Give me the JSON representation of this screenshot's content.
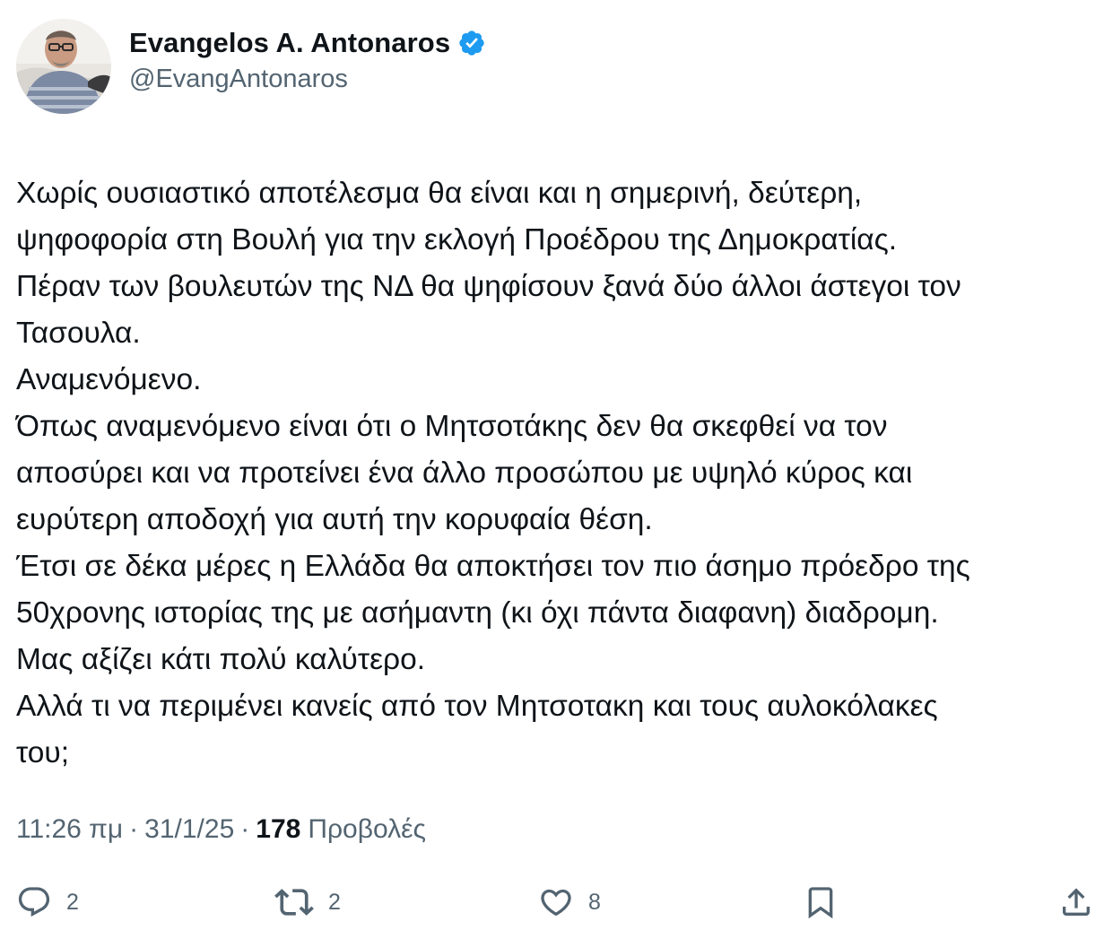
{
  "author": {
    "display_name": "Evangelos A. Antonaros",
    "handle": "@EvangAntonaros",
    "verified": true,
    "verified_color": "#1d9bf0"
  },
  "tweet": {
    "lines": [
      "Χωρίς ουσιαστικό αποτέλεσμα θα είναι και η σημερινή, δεύτερη,",
      "ψηφοφορία στη Βουλή για την εκλογή  Προέδρου της Δημοκρατίας.",
      "Πέραν των βουλευτών της ΝΔ θα ψηφίσουν ξανά δύο άλλοι άστεγοι τον",
      "Τασουλα.",
      "Αναμενόμενο.",
      "Όπως αναμενόμενο είναι ότι ο Μητσοτάκης δεν θα σκεφθεί να τον",
      "αποσύρει και να προτείνει ένα άλλο προσώπου με υψηλό κύρος και",
      "ευρύτερη αποδοχή για αυτή την κορυφαία θέση.",
      "Έτσι σε δέκα μέρες η Ελλάδα θα αποκτήσει τον πιο άσημο πρόεδρο της",
      "50χρονης ιστορίας της με ασήμαντη (κι όχι πάντα διαφανη)  διαδρομη.",
      "Μας αξίζει κάτι πολύ καλύτερο.",
      "Αλλά τι να περιμένει κανείς από τον Μητσοτακη και τους αυλοκόλακες",
      "του;"
    ]
  },
  "meta": {
    "time": "11:26 πμ",
    "separator": "·",
    "date": "31/1/25",
    "views_count": "178",
    "views_label": "Προβολές"
  },
  "actions": {
    "reply": {
      "icon": "reply-icon",
      "count": "2"
    },
    "retweet": {
      "icon": "retweet-icon",
      "count": "2"
    },
    "like": {
      "icon": "heart-icon",
      "count": "8"
    },
    "bookmark": {
      "icon": "bookmark-icon"
    },
    "share": {
      "icon": "share-icon"
    }
  },
  "colors": {
    "text_primary": "#0f1419",
    "text_secondary": "#536471",
    "accent": "#1d9bf0"
  }
}
